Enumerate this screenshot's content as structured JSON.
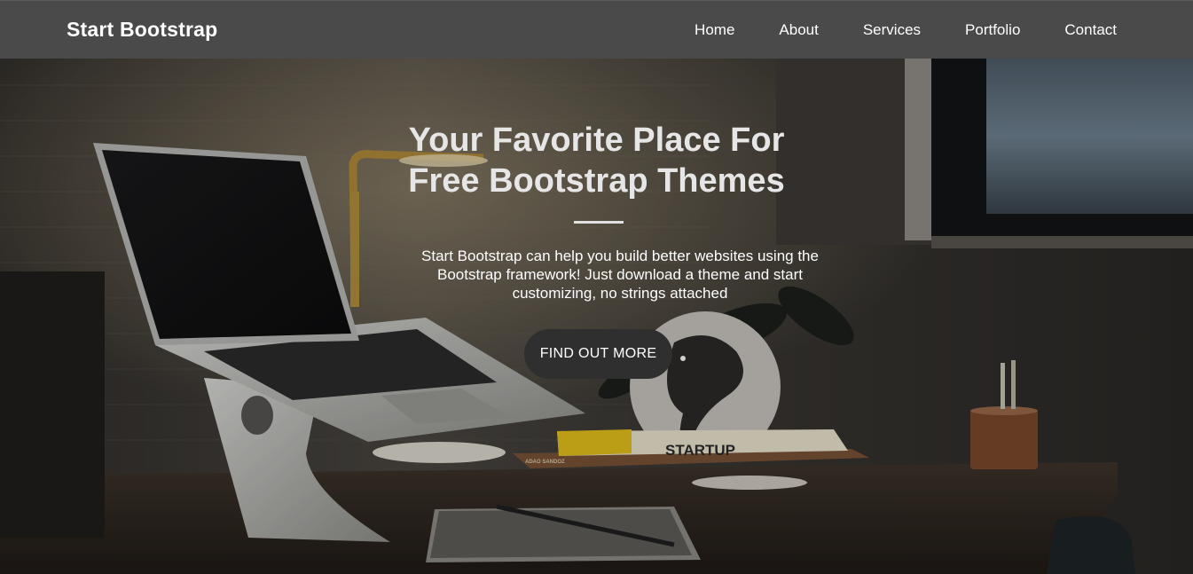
{
  "navbar": {
    "brand": "Start Bootstrap",
    "links": [
      {
        "label": "Home"
      },
      {
        "label": "About"
      },
      {
        "label": "Services"
      },
      {
        "label": "Portfolio"
      },
      {
        "label": "Contact"
      }
    ]
  },
  "hero": {
    "headline_line1": "Your Favorite Place For",
    "headline_line2": "Free Bootstrap Themes",
    "lead": "Start Bootstrap can help you build better websites using the Bootstrap framework! Just download a theme and start customizing, no strings attached",
    "cta_label": "FIND OUT MORE",
    "book_title": "STARTUP",
    "book_author": "ADAO SANDOZ"
  },
  "colors": {
    "navbar_bg": "#4a4a4a",
    "cta_bg": "#2f2f2f",
    "text_light": "#ffffff"
  }
}
